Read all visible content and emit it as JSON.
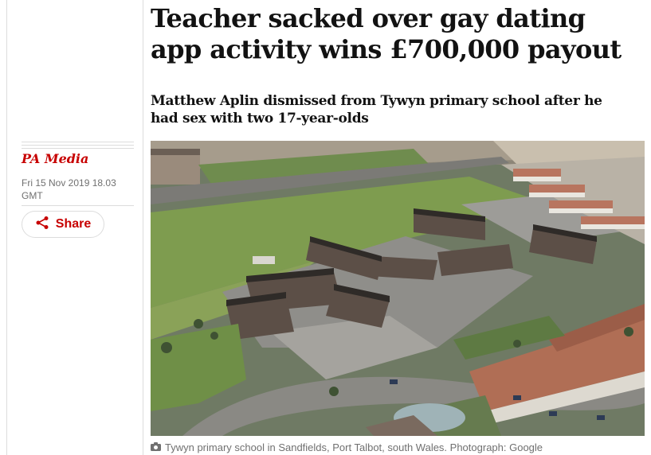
{
  "article": {
    "headline": "Teacher sacked over gay dating app activity wins £700,000 payout",
    "standfirst": "Matthew Aplin dismissed from Tywyn primary school after he had sex with two 17-year-olds"
  },
  "meta": {
    "byline": "PA Media",
    "date": "Fri 15 Nov 2019 18.03 GMT",
    "share_label": "Share",
    "share_icon": "share-icon",
    "accent_color": "#c70000"
  },
  "image": {
    "caption": "Tywyn primary school in Sandfields, Port Talbot, south Wales. Photograph: Google",
    "caption_icon": "camera-icon"
  }
}
